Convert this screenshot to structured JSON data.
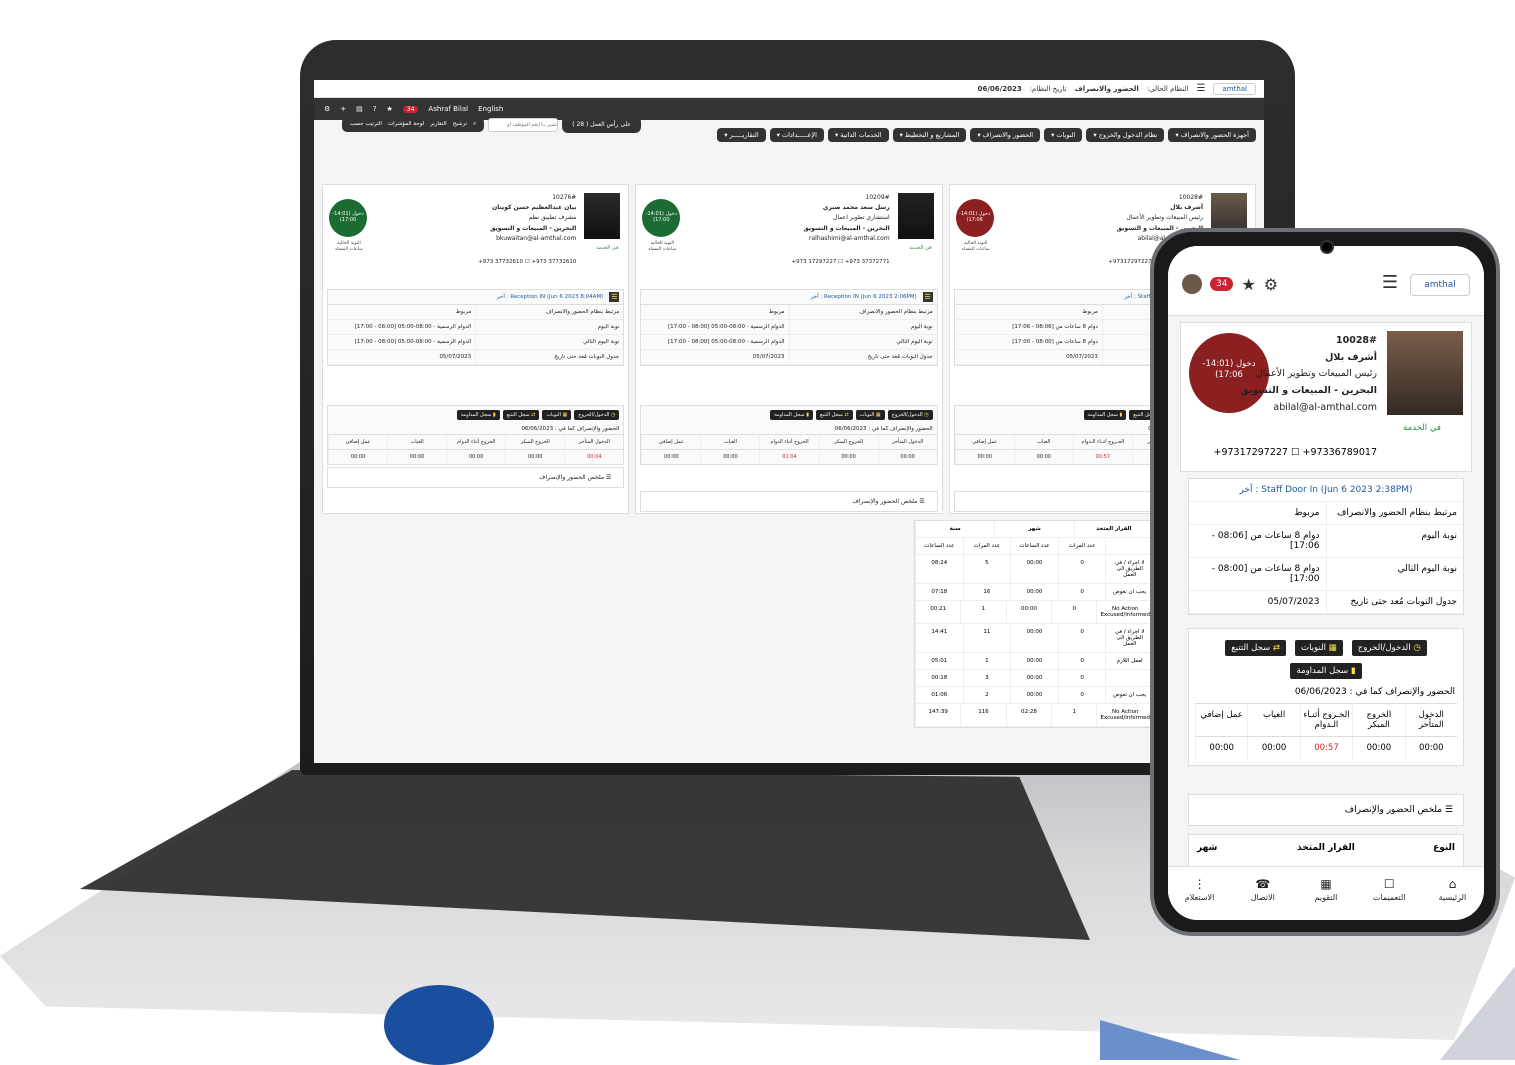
{
  "app": {
    "logo": "amthal",
    "system_label": "النظام الحالي:",
    "system_name": "الحضور والانصراف",
    "date_label": "تاريخ النظام:",
    "date_value": "06/06/2023"
  },
  "toolbar": {
    "notif_count": "34",
    "user_name": "Ashraf Bilal",
    "language": "English",
    "help": "?",
    "star": "★"
  },
  "nav": {
    "items": [
      "أجهزة الحضور والانصراف ▾",
      "نظام الدخول والخروج ▾",
      "النوبات ▾",
      "الحضور والانصراف ▾",
      "المشاريع و التخطيط ▾",
      "الخدمات الذاتية ▾",
      "الإعـــــدادات ▾",
      "التقاريـــــر ▾"
    ],
    "team_label": "على رأس العمل ( 28 )",
    "search_placeholder": "تشير بـأ إنقم الموظف أو",
    "filter_labels": [
      "ترشيح",
      "التقارير",
      "لوحة المؤشرات",
      "الترتيب حسب"
    ]
  },
  "cards": [
    {
      "id": "10028#",
      "name": "أشرف بلال",
      "title": "رئيس المبيعات وتطوير الأعمال",
      "dept": "البحرين - المبيعات و التسويق",
      "email": "abilal@al-amthal.com",
      "phone": "97336789017+ ☐ 97317297227+",
      "status": "دخول (14:01-17:06)",
      "color": "#8c1f1f",
      "in_service": "في الخدمة",
      "cur_shift": "النوبة الحالية",
      "cur_shift2": "ساعات المساء",
      "last": "Staff Door In (Jun 6 2023 2:38PM) : آخر",
      "rows": [
        [
          "مرتبط بنظام الحضور والانصراف",
          "مربوط"
        ],
        [
          "نوبة اليوم",
          "دوام 8 ساعات من [08:06 - 17:06]"
        ],
        [
          "نوبة اليوم التالي",
          "دوام 8 ساعات من [08:00 - 17:00]"
        ],
        [
          "جدول النوبات مُعد حتى تاريخ",
          "05/07/2023"
        ]
      ],
      "asof": "الحضور والإنصراف كما في : 06/06/2023",
      "cols": [
        "الدخول المتأخر",
        "الخروج المبكر",
        "الخـروج أثنـاء الـدوام",
        "الغياب",
        "عمل إضافي"
      ],
      "vals": [
        "00:00",
        "00:00",
        "00:57",
        "00:00",
        "00:00"
      ]
    },
    {
      "id": "10209#",
      "name": "رسل سعد محمد صبري",
      "title": "استشاري تطوير اعمال",
      "dept": "البحرين - المبيعات و التسويق",
      "email": "ralhashimi@al-amthal.com",
      "phone": "37372771 973+ ☐ 17297227 973+",
      "status": "دخول (14:01-17:00)",
      "color": "#1b6b33",
      "in_service": "في الخدمة",
      "cur_shift": "النوبة الحالية",
      "cur_shift2": "ساعات المساء",
      "last": "Reception IN (Jun 6 2023 2:06PM) : آخر",
      "rows": [
        [
          "مرتبط بنظام الحضور والانصراف",
          "مربوط"
        ],
        [
          "نوبة اليوم",
          "الدوام الرسمية - 08:00-05:00 [08:00 - 17:00]"
        ],
        [
          "نوبة اليوم التالي",
          "الدوام الرسمية - 08:00-05:00 [08:00 - 17:00]"
        ],
        [
          "جدول النوبات مُعد حتى تاريخ",
          "05/07/2023"
        ]
      ],
      "asof": "الحضور والإنصراف كما في : 06/06/2023",
      "cols": [
        "الدخول المتأخر",
        "الخروج المبكر",
        "الخروج أثناء الدوام",
        "الغياب",
        "عمل إضافي"
      ],
      "vals": [
        "00:00",
        "00:00",
        "01:04",
        "00:00",
        "00:00"
      ]
    },
    {
      "id": "10276#",
      "name": "بيان عبدالعظيم حسن كويتان",
      "title": "مشرف تطبيق نظم",
      "dept": "البحرين - المبيعات و التسويق",
      "email": "bkuwaitan@al-amthal.com",
      "phone": "37732610 973+ ☐ 37732610 973+",
      "status": "دخول (14:01-17:00)",
      "color": "#1b6b33",
      "in_service": "في الخدمة",
      "cur_shift": "النوبة الحالية",
      "cur_shift2": "ساعات المساء",
      "last": "Reception IN (Jun 6 2023 8:04AM) : آخر",
      "rows": [
        [
          "مرتبط بنظام الحضور والانصراف",
          "مربوط"
        ],
        [
          "نوبة اليوم",
          "الدوام الرسمية - 08:00-05:00 [08:00 - 17:00]"
        ],
        [
          "نوبة اليوم التالي",
          "الدوام الرسمية - 08:00-05:00 [08:00 - 17:00]"
        ],
        [
          "جدول النوبات مُعد حتى تاريخ",
          "05/07/2023"
        ]
      ],
      "asof": "الحضور والإنصراف كما في : 06/06/2023",
      "cols": [
        "الدخول المتأخر",
        "الخروج المبكر",
        "الخروج أثناء الدوام",
        "الغياب",
        "عمل إضافي"
      ],
      "vals": [
        "00:04",
        "00:00",
        "00:00",
        "00:00",
        "00:00"
      ]
    }
  ],
  "buttons": {
    "inout": "الدخول/الخروج",
    "shifts": "النوبات",
    "tracking": "سجل التتبع",
    "attendance": "سجل المداومة"
  },
  "summary": "ملخص الحضور والإنصراف",
  "bigtable": {
    "h_decision": "القرار المتخذ",
    "h_month": "شهر",
    "h_year": "سنة",
    "h_count": "عدد المرات",
    "h_hours": "عدد الساعات",
    "rows": [
      [
        "لا اجراء / في الطريق الى العمل",
        "0",
        "00:00",
        "5",
        "08:24"
      ],
      [
        "يجب ان تعوض",
        "0",
        "00:00",
        "16",
        "07:18"
      ],
      [
        "No Action Excused/Informed",
        "0",
        "00:00",
        "1",
        "00:21"
      ],
      [
        "لا اجراء / في الطريق الى العمل",
        "0",
        "00:00",
        "11",
        "14:41"
      ],
      [
        "لعمل اللازم",
        "0",
        "00:00",
        "1",
        "05:01"
      ],
      [
        "",
        "0",
        "00:00",
        "3",
        "00:18"
      ],
      [
        "يجب ان تعوض",
        "0",
        "00:00",
        "2",
        "01:06"
      ],
      [
        "No Action Excused/Informed",
        "1",
        "02:28",
        "116",
        "147:39"
      ]
    ]
  },
  "phone": {
    "notif": "34",
    "summary": "ملخص الحضور والإنصراف",
    "type_h": "النوع",
    "decision_h": "القرار المتخذ",
    "month_h": "شهر",
    "count_h": "عدد المرات",
    "nav": [
      [
        "⌂",
        "الرئيسية"
      ],
      [
        "☐",
        "التعميمات"
      ],
      [
        "▦",
        "التقويم"
      ],
      [
        "☎",
        "الاتصال"
      ],
      [
        "⋮",
        "الاستعلام"
      ]
    ]
  }
}
